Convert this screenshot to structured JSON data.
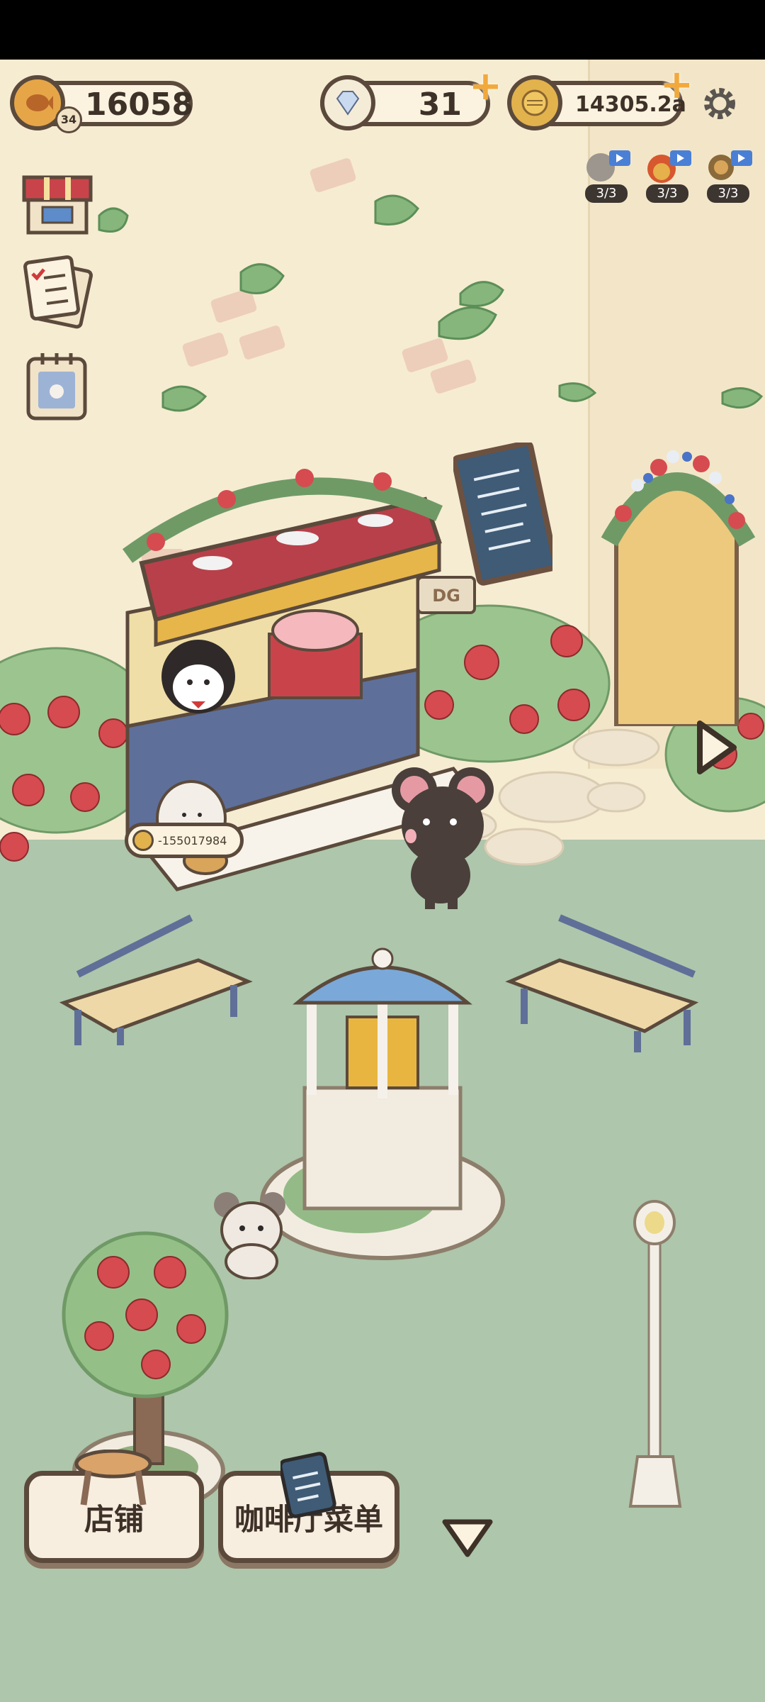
{
  "resources": {
    "fish": {
      "value": "16058",
      "level": "34",
      "icon": "fish-currency-icon"
    },
    "diamond": {
      "value": "31",
      "icon": "diamond-icon"
    },
    "coin": {
      "value": "14305.2a",
      "icon": "coin-icon"
    }
  },
  "boosts": [
    {
      "icon": "cat-boost-icon",
      "count": "3/3"
    },
    {
      "icon": "coin-fire-boost-icon",
      "count": "3/3"
    },
    {
      "icon": "cookie-boost-icon",
      "count": "3/3"
    }
  ],
  "stand_earning": "-155017984",
  "stand_sign": "DG",
  "bottom": {
    "shop_label": "店铺",
    "menu_label": "咖啡厅菜单"
  },
  "colors": {
    "grass": "#aec6ab",
    "wall": "#f6ecd2",
    "awning": "#b8404a",
    "outline": "#5b4a3c"
  }
}
